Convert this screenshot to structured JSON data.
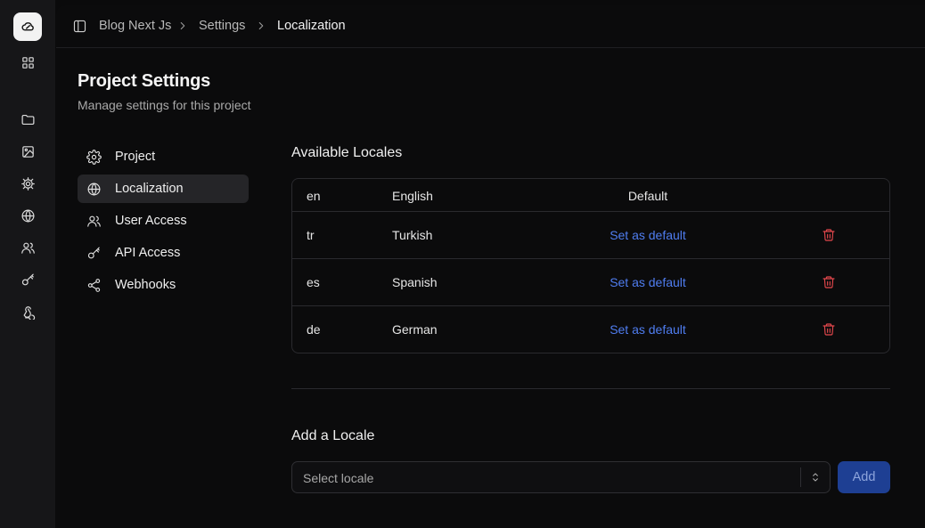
{
  "rail": {
    "icons": [
      "apps-grid-icon",
      "folder-icon",
      "image-icon",
      "settings-icon",
      "globe-icon",
      "users-icon",
      "key-icon",
      "webhook-icon"
    ]
  },
  "breadcrumb": {
    "items": [
      "Blog Next Js",
      "Settings",
      "Localization"
    ]
  },
  "header": {
    "title": "Project Settings",
    "subtitle": "Manage settings for this project"
  },
  "nav": {
    "items": [
      {
        "label": "Project",
        "icon": "gear-icon"
      },
      {
        "label": "Localization",
        "icon": "globe-icon",
        "active": true
      },
      {
        "label": "User Access",
        "icon": "users-icon"
      },
      {
        "label": "API Access",
        "icon": "key-icon"
      },
      {
        "label": "Webhooks",
        "icon": "share-icon"
      }
    ]
  },
  "locales": {
    "title": "Available Locales",
    "rows": [
      {
        "code": "en",
        "name": "English",
        "status": "Default"
      },
      {
        "code": "tr",
        "name": "Turkish",
        "action": "Set as default"
      },
      {
        "code": "es",
        "name": "Spanish",
        "action": "Set as default"
      },
      {
        "code": "de",
        "name": "German",
        "action": "Set as default"
      }
    ]
  },
  "add_locale": {
    "title": "Add a Locale",
    "placeholder": "Select locale",
    "button": "Add"
  },
  "colors": {
    "accent": "#4f7df0",
    "danger": "#e5484d",
    "button_bg": "#1e3f93"
  }
}
